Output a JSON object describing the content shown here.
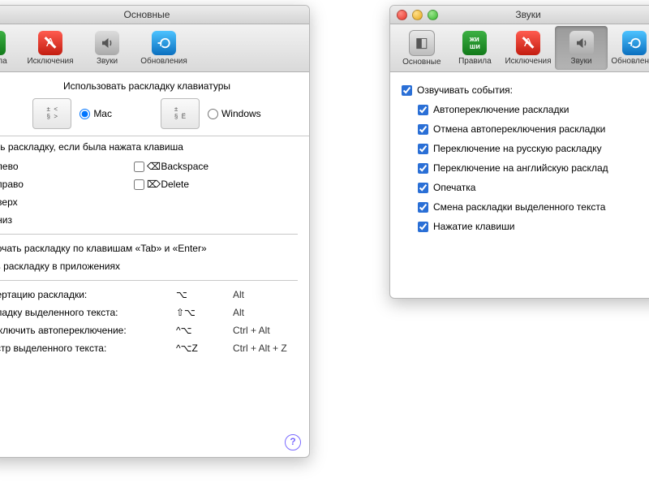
{
  "win1": {
    "title": "Основные",
    "toolbar": [
      {
        "label": "равила",
        "sel": false,
        "icon": "rules"
      },
      {
        "label": "Исключения",
        "sel": false,
        "icon": "excl"
      },
      {
        "label": "Звуки",
        "sel": false,
        "icon": "sounds"
      },
      {
        "label": "Обновления",
        "sel": false,
        "icon": "updates"
      }
    ],
    "use_layout_heading": "Использовать раскладку клавиатуры",
    "mac_label": "Mac",
    "win_label": "Windows",
    "switch_heading": "ключать раскладку, если была нажата клавиша",
    "arrow_left": "елка влево",
    "arrow_right": "елка вправо",
    "arrow_up": "елка вверх",
    "arrow_down": "елка вниз",
    "backspace": "Backspace",
    "delete": "Delete",
    "dont_switch": "ереключать раскладку по клавишам «Tab» и «Enter»",
    "remember": "минать раскладку в приложениях",
    "shortcuts": [
      {
        "label": "ь конвертацию раскладки:",
        "sym": "⌥",
        "txt": "Alt"
      },
      {
        "label": "ь раскладку выделенного текста:",
        "sym": "⇧⌥",
        "txt": "Alt"
      },
      {
        "label": "ить/выключить автопереключение:",
        "sym": "^⌥",
        "txt": "Ctrl + Alt"
      },
      {
        "label": "ь регистр выделенного текста:",
        "sym": "^⌥Z",
        "txt": "Ctrl + Alt + Z"
      }
    ]
  },
  "win2": {
    "title": "Звуки",
    "toolbar": [
      {
        "label": "Основные",
        "sel": false,
        "icon": "basic"
      },
      {
        "label": "Правила",
        "sel": false,
        "icon": "rules"
      },
      {
        "label": "Исключения",
        "sel": false,
        "icon": "excl"
      },
      {
        "label": "Звуки",
        "sel": true,
        "icon": "sounds"
      },
      {
        "label": "Обновления",
        "sel": false,
        "icon": "updates"
      }
    ],
    "voice_events": "Озвучивать события:",
    "items": [
      "Автопереключение раскладки",
      "Отмена автопереключения раскладки",
      "Переключение на русскую раскладку",
      "Переключение на английскую расклад",
      "Опечатка",
      "Смена раскладки выделенного текста",
      "Нажатие клавиши"
    ]
  }
}
